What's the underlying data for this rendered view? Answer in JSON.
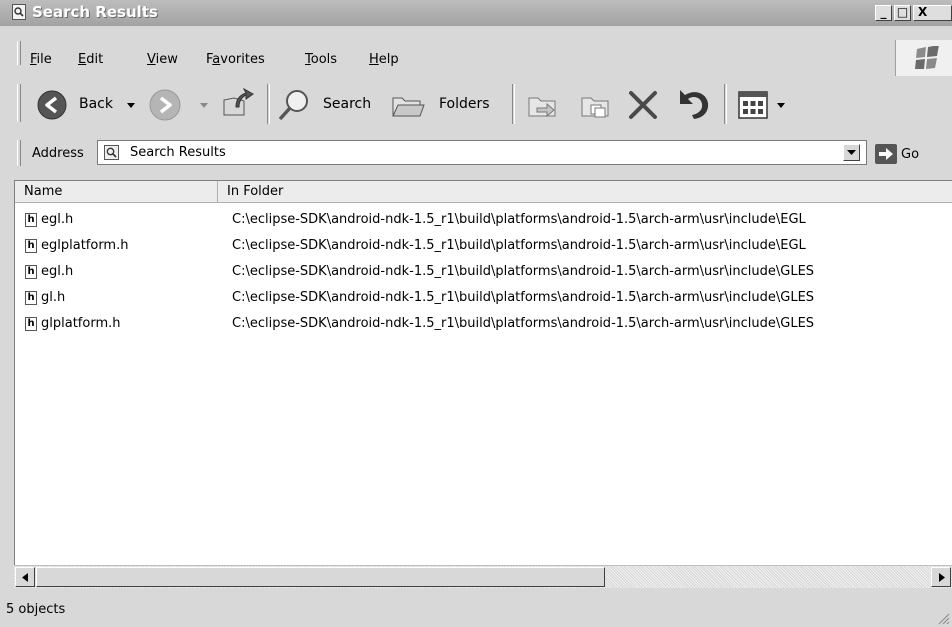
{
  "window": {
    "title": "Search Results"
  },
  "title_buttons": {
    "minimize": "_",
    "maximize": "□",
    "close": "X"
  },
  "menu": [
    {
      "pre": "",
      "key": "F",
      "post": "ile"
    },
    {
      "pre": "",
      "key": "E",
      "post": "dit"
    },
    {
      "pre": "",
      "key": "V",
      "post": "iew"
    },
    {
      "pre": "F",
      "key": "a",
      "post": "vorites"
    },
    {
      "pre": "",
      "key": "T",
      "post": "ools"
    },
    {
      "pre": "",
      "key": "H",
      "post": "elp"
    }
  ],
  "toolbar": {
    "back_label": "Back",
    "search_label": "Search",
    "folders_label": "Folders"
  },
  "address": {
    "label": "Address",
    "value": "Search Results",
    "go_label": "Go"
  },
  "columns": {
    "name": "Name",
    "folder": "In Folder"
  },
  "files": [
    {
      "name": "egl.h",
      "folder": "C:\\eclipse-SDK\\android-ndk-1.5_r1\\build\\platforms\\android-1.5\\arch-arm\\usr\\include\\EGL"
    },
    {
      "name": "eglplatform.h",
      "folder": "C:\\eclipse-SDK\\android-ndk-1.5_r1\\build\\platforms\\android-1.5\\arch-arm\\usr\\include\\EGL"
    },
    {
      "name": "egl.h",
      "folder": "C:\\eclipse-SDK\\android-ndk-1.5_r1\\build\\platforms\\android-1.5\\arch-arm\\usr\\include\\GLES"
    },
    {
      "name": "gl.h",
      "folder": "C:\\eclipse-SDK\\android-ndk-1.5_r1\\build\\platforms\\android-1.5\\arch-arm\\usr\\include\\GLES"
    },
    {
      "name": "glplatform.h",
      "folder": "C:\\eclipse-SDK\\android-ndk-1.5_r1\\build\\platforms\\android-1.5\\arch-arm\\usr\\include\\GLES"
    }
  ],
  "file_icon_glyph": "h",
  "status": {
    "text": "5 objects"
  }
}
